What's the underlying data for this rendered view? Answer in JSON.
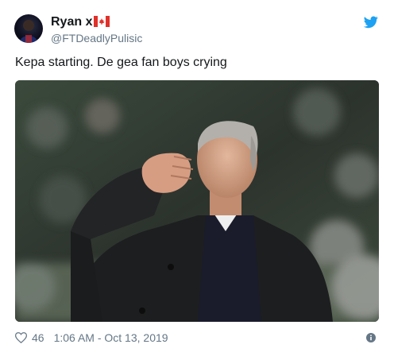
{
  "tweet": {
    "display_name": "Ryan x",
    "handle": "@FTDeadlyPulisic",
    "text": "Kepa starting. De gea fan boys crying",
    "like_count": "46",
    "timestamp": "1:06 AM - Oct 13, 2019"
  },
  "icons": {
    "avatar": "avatar",
    "flag": "canada-flag-icon",
    "brand": "twitter-bird-icon",
    "like": "heart-icon",
    "info": "info-icon"
  },
  "colors": {
    "brand_blue": "#1da1f2",
    "flag_red": "#e0302a",
    "secondary_text": "#657786",
    "primary_text": "#14171a"
  }
}
